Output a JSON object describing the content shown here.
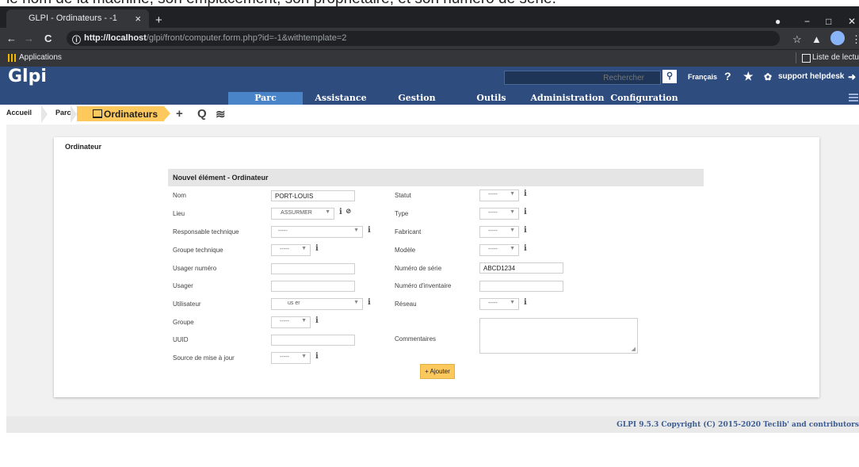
{
  "caption": "le nom de la machine, son emplacement, son propriétaire, et son numéro de série.",
  "browser": {
    "tab_title": "GLPI - Ordinateurs - -1",
    "tab_close": "×",
    "new_tab": "+",
    "url_host": "http://localhost",
    "url_path": "/glpi/front/computer.form.php?id=-1&withtemplate=2",
    "bookmarks_apps": "Applications",
    "reading_list": "Liste de lecture"
  },
  "glpi": {
    "logo": "Glpi",
    "search_placeholder": "Rechercher",
    "language": "Français",
    "help": "?",
    "favorite": "★",
    "user": "support helpdesk",
    "menu": [
      "Parc",
      "Assistance",
      "Gestion",
      "Outils",
      "Administration",
      "Configuration"
    ],
    "active_menu": "Parc"
  },
  "breadcrumb": {
    "home": "Accueil",
    "parc": "Parc",
    "current": "Ordinateurs",
    "add": "+",
    "search": "Q",
    "templates": "≋"
  },
  "form": {
    "section_title": "Ordinateur",
    "header": "Nouvel élément - Ordinateur",
    "left": {
      "nom_label": "Nom",
      "nom_value": "PORT-LOUIS",
      "lieu_label": "Lieu",
      "lieu_value": "ASSURMER",
      "resp_label": "Responsable technique",
      "resp_value": "-----",
      "groupe_tech_label": "Groupe technique",
      "groupe_tech_value": "-----",
      "usager_num_label": "Usager numéro",
      "usager_num_value": "",
      "usager_label": "Usager",
      "usager_value": "",
      "utilisateur_label": "Utilisateur",
      "utilisateur_value": "us er",
      "groupe_label": "Groupe",
      "groupe_value": "-----",
      "uuid_label": "UUID",
      "uuid_value": "",
      "source_label": "Source de mise à jour",
      "source_value": "-----"
    },
    "right": {
      "statut_label": "Statut",
      "statut_value": "-----",
      "type_label": "Type",
      "type_value": "-----",
      "fabricant_label": "Fabricant",
      "fabricant_value": "-----",
      "modele_label": "Modèle",
      "modele_value": "-----",
      "serie_label": "Numéro de série",
      "serie_value": "ABCD1234",
      "inventaire_label": "Numéro d'inventaire",
      "inventaire_value": "",
      "reseau_label": "Réseau",
      "reseau_value": "-----",
      "commentaires_label": "Commentaires"
    },
    "add_button": "+ Ajouter"
  },
  "footer": "GLPI 9.5.3 Copyright (C) 2015-2020 Teclib' and contributors"
}
